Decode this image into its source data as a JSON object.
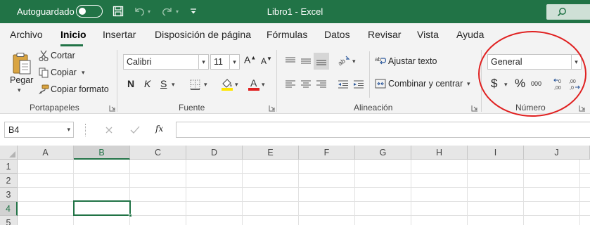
{
  "titlebar": {
    "autosave_label": "Autoguardado",
    "document_title": "Libro1  -  Excel"
  },
  "tabs": [
    "Archivo",
    "Inicio",
    "Insertar",
    "Disposición de página",
    "Fórmulas",
    "Datos",
    "Revisar",
    "Vista",
    "Ayuda"
  ],
  "ribbon": {
    "clipboard": {
      "paste": "Pegar",
      "cut": "Cortar",
      "copy": "Copiar",
      "format_painter": "Copiar formato",
      "label": "Portapapeles"
    },
    "font": {
      "font_name": "Calibri",
      "font_size": "11",
      "bold": "N",
      "italic": "K",
      "underline": "S",
      "label": "Fuente"
    },
    "alignment": {
      "wrap_text": "Ajustar texto",
      "merge_center": "Combinar y centrar",
      "label": "Alineación"
    },
    "number": {
      "format": "General",
      "currency": "$",
      "percent": "%",
      "thousands": "000",
      "label": "Número"
    }
  },
  "formula_bar": {
    "name_box": "B4",
    "fx": "fx",
    "formula": ""
  },
  "grid": {
    "columns": [
      "A",
      "B",
      "C",
      "D",
      "E",
      "F",
      "G",
      "H",
      "I",
      "J"
    ],
    "rows": [
      "1",
      "2",
      "3",
      "4",
      "5"
    ],
    "selected_cell": "B4"
  },
  "colors": {
    "excel_green": "#217346",
    "annotation_red": "#e02020",
    "highlight_yellow": "#ffe600",
    "font_red": "#e02020"
  }
}
